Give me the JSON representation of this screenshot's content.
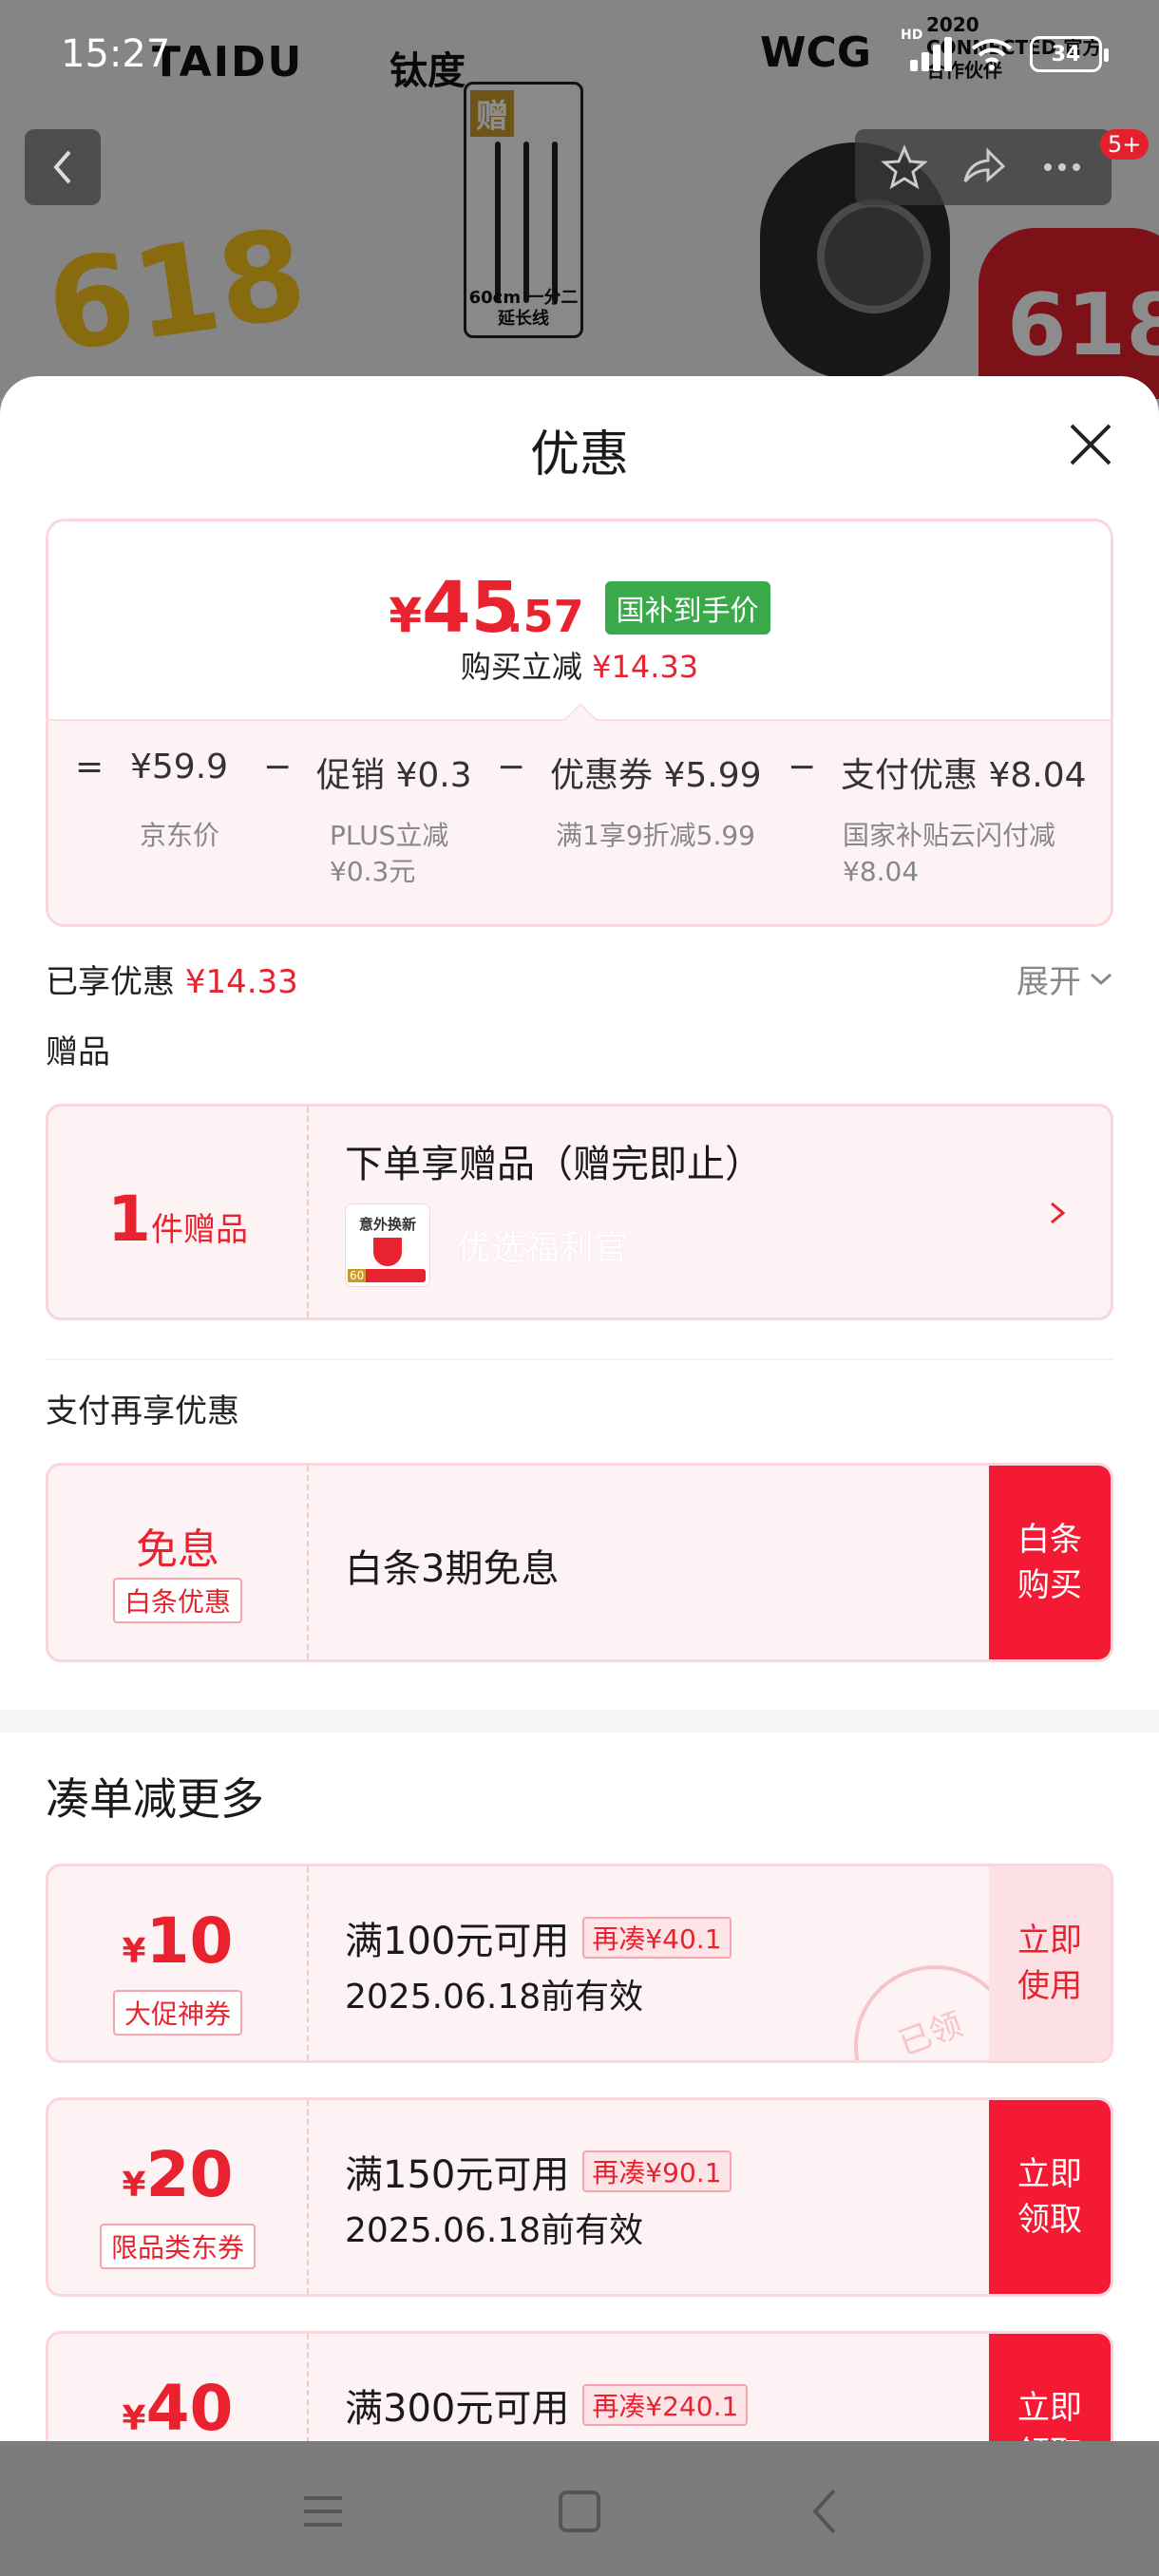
{
  "status_bar": {
    "time": "15:27",
    "signal_label": "HD",
    "battery": "34"
  },
  "background": {
    "brand_en": "TAIDU",
    "brand_cn": "钛度",
    "wcg": "WCG",
    "wcg_sub": "2020 CONNECTED 官方合作伙伴",
    "promo": "618",
    "gift_tag": "赠",
    "cable_text": "60cm 一分二延长线",
    "badge": "5+"
  },
  "sheet": {
    "title": "优惠",
    "close_icon": "close-icon"
  },
  "price": {
    "symbol": "¥",
    "integer": "45",
    "decimal": ".57",
    "tag": "国补到手价",
    "sub_label": "购买立减",
    "sub_value": "¥14.33",
    "formula": {
      "eq": "=",
      "jd_price": "¥59.9",
      "minus1": "−",
      "promo": "促销 ¥0.3",
      "minus2": "−",
      "coupon": "优惠券 ¥5.99",
      "minus3": "−",
      "pay": "支付优惠 ¥8.04"
    },
    "notes": {
      "jd_price": "京东价",
      "promo_line1": "PLUS立减",
      "promo_line2": "¥0.3元",
      "coupon": "满1享9折减5.99",
      "pay_line1": "国家补贴云闪付减",
      "pay_line2": "¥8.04"
    }
  },
  "summary": {
    "enjoyed_label": "已享优惠",
    "enjoyed_value": "¥14.33",
    "expand_label": "展开"
  },
  "gift": {
    "section_label": "赠品",
    "count": "1",
    "count_unit": "件赠品",
    "title": "下单享赠品（赠完即止）",
    "thumb_text": "意外换新",
    "thumb_badge": "60",
    "name": "优选福利官"
  },
  "pay": {
    "section_label": "支付再享优惠",
    "left_main": "免息",
    "left_tag": "白条优惠",
    "title": "白条3期免息",
    "btn_line1": "白条",
    "btn_line2": "购买"
  },
  "more": {
    "title": "凑单减更多",
    "coupons": [
      {
        "symbol": "¥",
        "amount": "10",
        "tag": "大促神券",
        "condition": "满100元可用",
        "extra": "再凑¥40.1",
        "date": "2025.06.18前有效",
        "btn_line1": "立即",
        "btn_line2": "使用",
        "stamp": "已领"
      },
      {
        "symbol": "¥",
        "amount": "20",
        "tag": "限品类东券",
        "condition": "满150元可用",
        "extra": "再凑¥90.1",
        "date": "2025.06.18前有效",
        "btn_line1": "立即",
        "btn_line2": "领取"
      },
      {
        "symbol": "¥",
        "amount": "40",
        "condition": "满300元可用",
        "extra": "再凑¥240.1",
        "btn_line1": "立即",
        "btn_line2": "领取"
      }
    ]
  },
  "system_nav": {
    "menu_icon": "menu-icon",
    "home_icon": "home-icon",
    "back_icon": "back-icon"
  },
  "colors": {
    "accent_red": "#e8232f",
    "button_red": "#f51a34",
    "gov_green": "#39a94a",
    "card_pink": "#fdf3f4"
  }
}
